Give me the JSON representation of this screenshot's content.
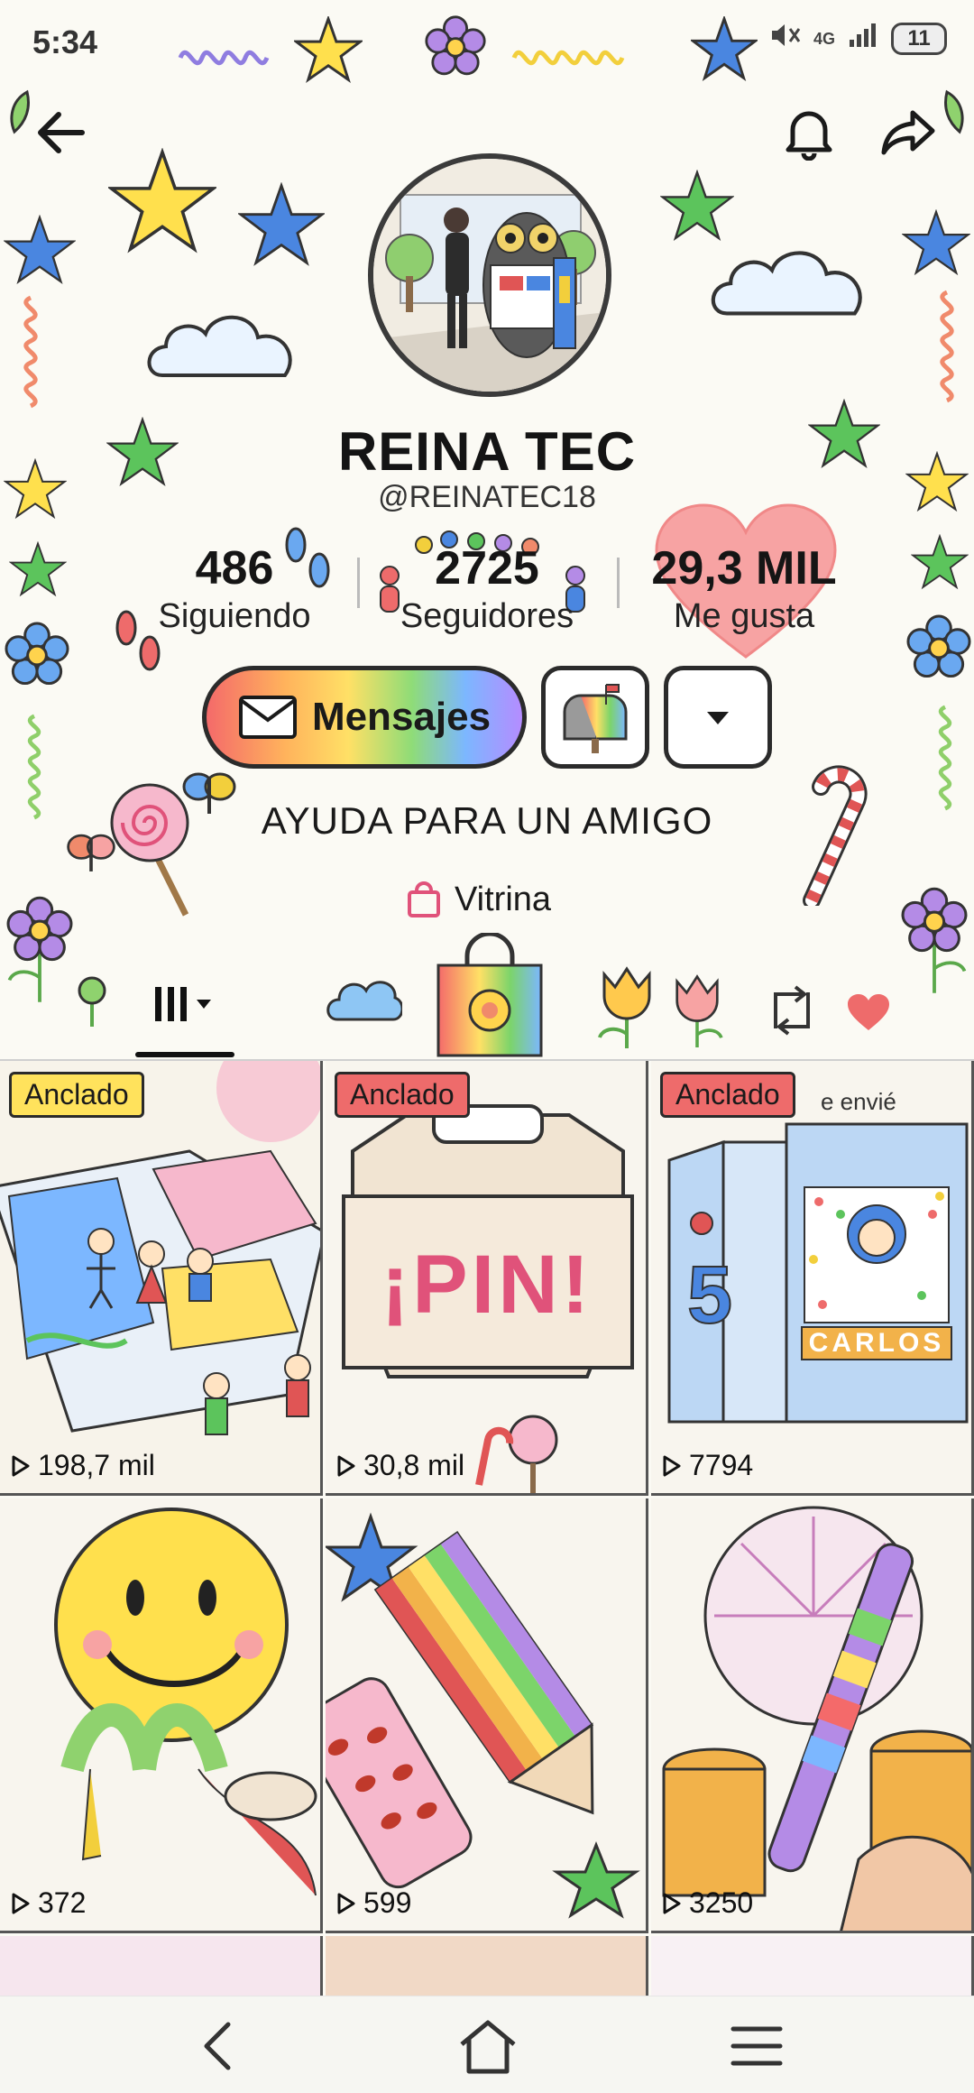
{
  "status_bar": {
    "time": "5:34",
    "network": "4G",
    "battery": "11"
  },
  "header": {
    "back_icon": "arrow-left",
    "bell_icon": "bell",
    "share_icon": "share-arrow"
  },
  "profile": {
    "name": "REINA TEC",
    "handle": "@REINATEC18"
  },
  "stats": [
    {
      "value": "486",
      "label": "Siguiendo"
    },
    {
      "value": "2725",
      "label": "Seguidores"
    },
    {
      "value": "29,3 MIL",
      "label": "Me gusta"
    }
  ],
  "actions": {
    "message_label": "Mensajes",
    "mailbox_icon": "mailbox",
    "dropdown_icon": "caret-down"
  },
  "bio": "AYUDA PARA UN AMIGO",
  "showcase_label": "Vitrina",
  "tabs": {
    "grid_icon": "grid-bars",
    "repost_icon": "repost",
    "liked_icon": "heart"
  },
  "videos": [
    {
      "pinned": "Anclado",
      "views": "198,7 mil",
      "caption": ""
    },
    {
      "pinned": "Anclado",
      "views": "30,8 mil",
      "caption": "¡PIN!"
    },
    {
      "pinned": "Anclado",
      "views": "7794",
      "caption": "CARLOS"
    },
    {
      "pinned": "",
      "views": "372",
      "caption": ""
    },
    {
      "pinned": "",
      "views": "599",
      "caption": ""
    },
    {
      "pinned": "",
      "views": "3250",
      "caption": ""
    }
  ],
  "tile3_extra": "e envié",
  "colors": {
    "accent_red": "#ee6b6b",
    "accent_yellow": "#ffe25c",
    "background": "#fbfaf4"
  }
}
